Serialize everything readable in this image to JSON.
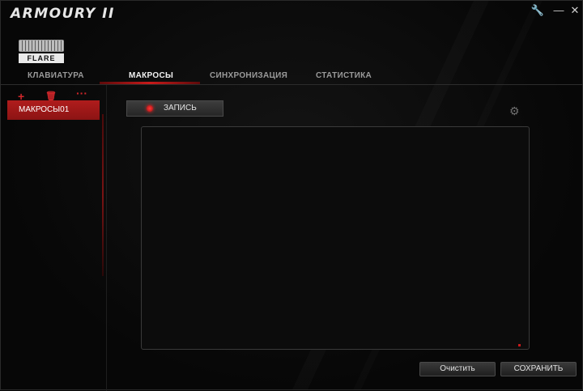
{
  "app": {
    "title": "ARMOURY II"
  },
  "window_controls": {
    "tool": "🔧",
    "minimize": "—",
    "close": "✕"
  },
  "device": {
    "name": "FLARE"
  },
  "tabs": [
    {
      "label": "КЛАВИАТУРА"
    },
    {
      "label": "МАКРОСЫ",
      "active": true
    },
    {
      "label": "СИНХРОНИЗАЦИЯ"
    },
    {
      "label": "СТАТИСТИКА"
    }
  ],
  "sidebar": {
    "tools": [
      {
        "icon": "plus-icon",
        "glyph": "+"
      },
      {
        "icon": "trash-icon",
        "glyph": "🗑"
      },
      {
        "icon": "more-icon",
        "glyph": "···"
      }
    ],
    "macros": [
      {
        "label": "МАКРОСЫ01",
        "selected": true
      }
    ]
  },
  "record": {
    "label": "ЗАПИСЬ"
  },
  "settings_glyph": "⚙",
  "buttons": {
    "clear": "Очистить",
    "save": "СОХРАНИТЬ"
  },
  "colors": {
    "accent": "#c81a1a",
    "background": "#060606"
  }
}
